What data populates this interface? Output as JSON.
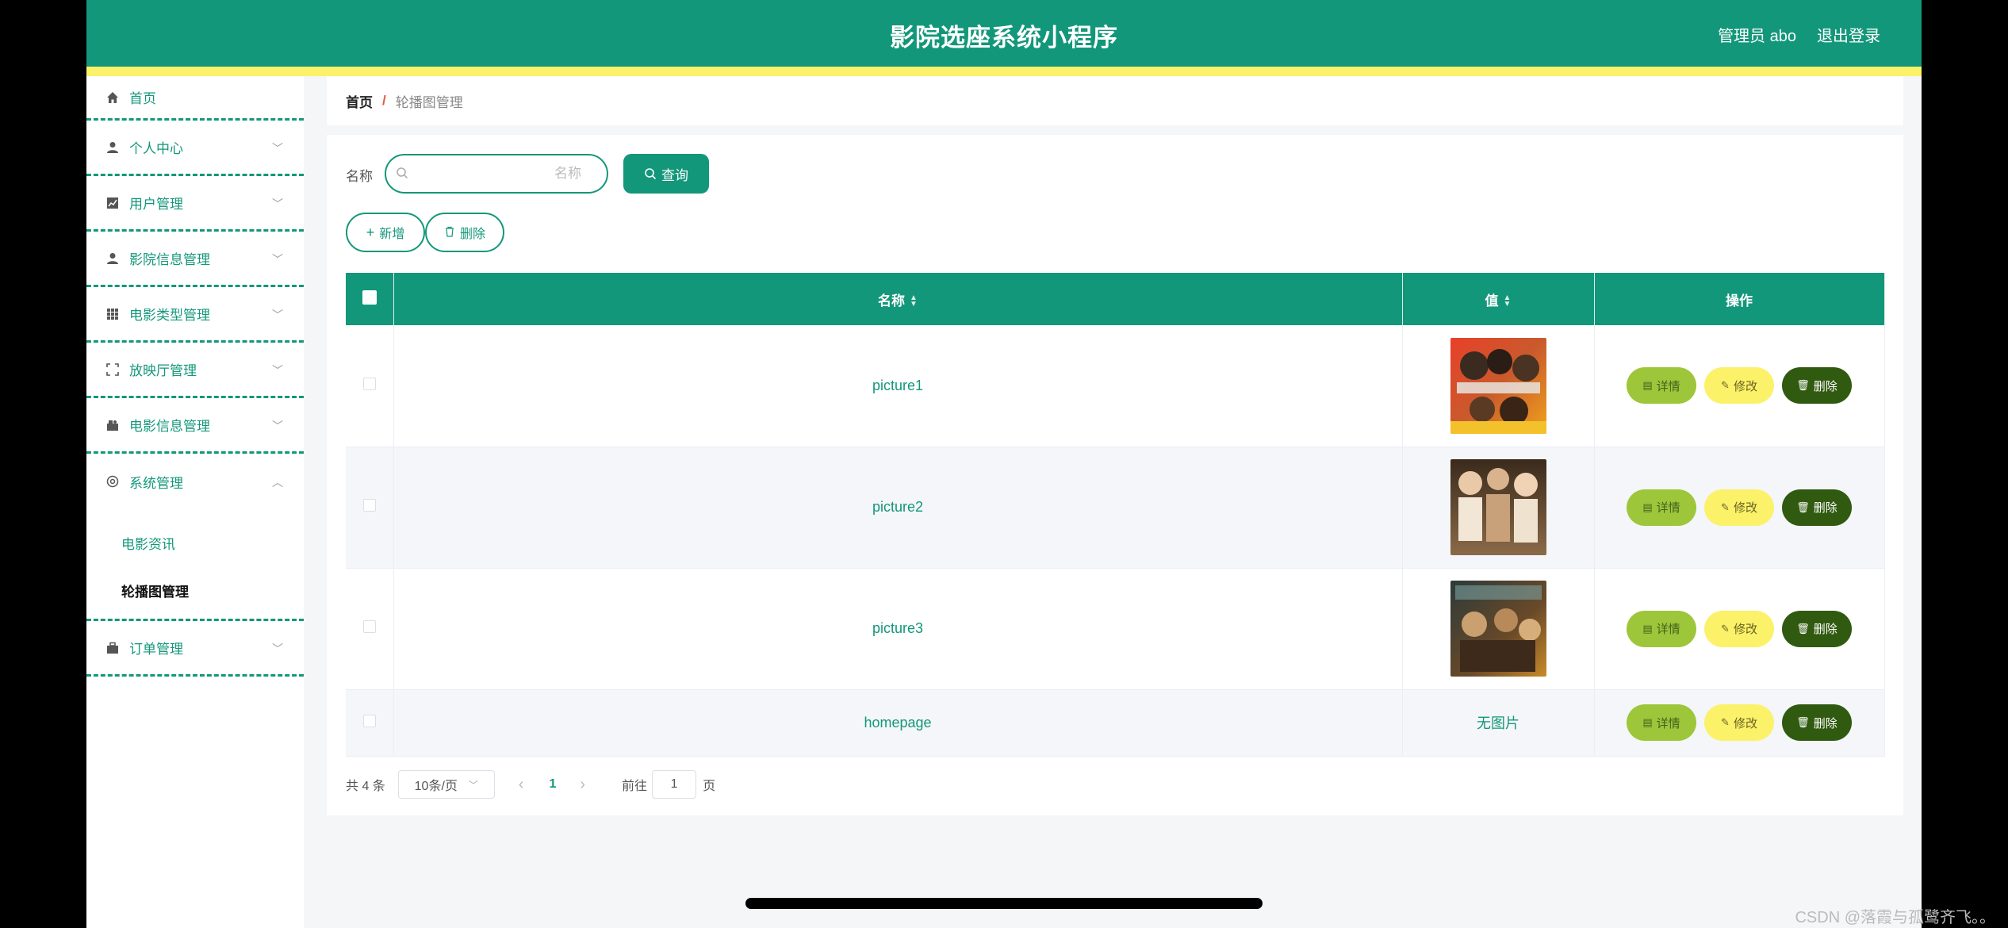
{
  "header": {
    "title": "影院选座系统小程序",
    "admin": "管理员 abo",
    "logout": "退出登录",
    "color": "#13977a",
    "stripe_color": "#fbf26a"
  },
  "sidebar": {
    "items": [
      {
        "label": "首页",
        "icon": "home-icon"
      },
      {
        "label": "个人中心",
        "icon": "user-icon"
      },
      {
        "label": "用户管理",
        "icon": "chart-icon"
      },
      {
        "label": "影院信息管理",
        "icon": "user-icon"
      },
      {
        "label": "电影类型管理",
        "icon": "grid-icon"
      },
      {
        "label": "放映厅管理",
        "icon": "fullscreen-icon"
      },
      {
        "label": "电影信息管理",
        "icon": "camera-icon"
      },
      {
        "label": "系统管理",
        "icon": "settings-icon"
      },
      {
        "label": "订单管理",
        "icon": "briefcase-icon"
      }
    ],
    "submenu": [
      "电影资讯",
      "轮播图管理"
    ]
  },
  "breadcrumb": {
    "home": "首页",
    "separator": "/",
    "current": "轮播图管理"
  },
  "search": {
    "label": "名称",
    "placeholder": "名称",
    "button": "查询"
  },
  "actions": {
    "add": "新增",
    "delete": "删除"
  },
  "table": {
    "headers": {
      "name": "名称",
      "value": "值",
      "ops": "操作"
    },
    "rows": [
      {
        "name": "picture1",
        "value": "image"
      },
      {
        "name": "picture2",
        "value": "image"
      },
      {
        "name": "picture3",
        "value": "image"
      },
      {
        "name": "homepage",
        "value": "无图片"
      }
    ],
    "op_labels": {
      "detail": "详情",
      "edit": "修改",
      "delete": "删除"
    }
  },
  "pagination": {
    "total": "共 4 条",
    "page_size": "10条/页",
    "current_page": "1",
    "goto_label": "前往",
    "goto_value": "1",
    "page_unit": "页"
  },
  "watermark": "CSDN @落霞与孤鹭齐飞。。"
}
